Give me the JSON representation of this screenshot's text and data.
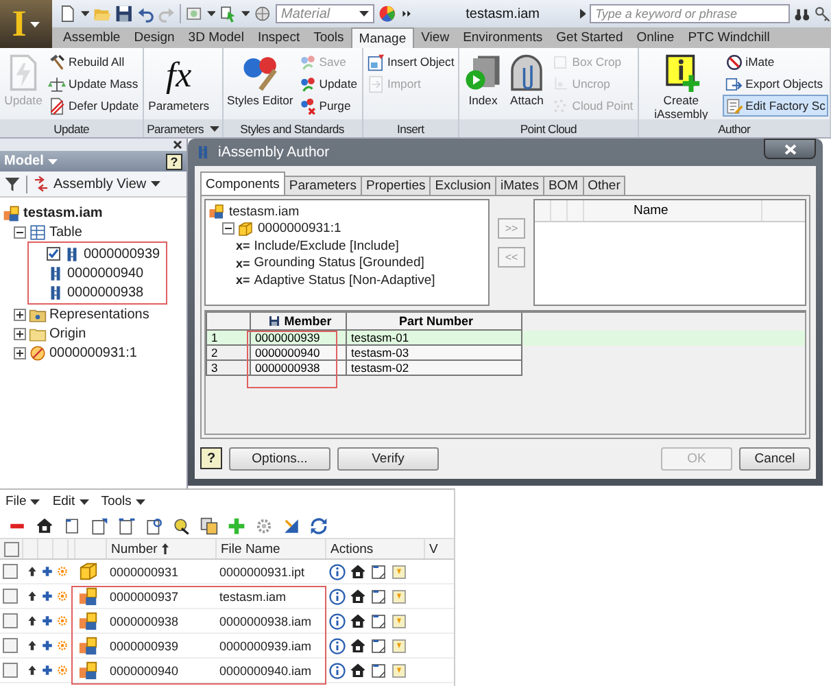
{
  "app_button": {
    "label": "I"
  },
  "quick_access": {
    "material": "Material"
  },
  "title": "testasm.iam",
  "search": {
    "placeholder": "Type a keyword or phrase"
  },
  "ribbon_tabs": [
    {
      "label": "Assemble",
      "selected": false
    },
    {
      "label": "Design",
      "selected": false
    },
    {
      "label": "3D Model",
      "selected": false
    },
    {
      "label": "Inspect",
      "selected": false
    },
    {
      "label": "Tools",
      "selected": false
    },
    {
      "label": "Manage",
      "selected": true
    },
    {
      "label": "View",
      "selected": false
    },
    {
      "label": "Environments",
      "selected": false
    },
    {
      "label": "Get Started",
      "selected": false
    },
    {
      "label": "Online",
      "selected": false
    },
    {
      "label": "PTC Windchill",
      "selected": false
    }
  ],
  "ribbon_panels": [
    {
      "title": "Update",
      "menu": false,
      "items": [
        {
          "kind": "large",
          "label": "Update",
          "disabled": true,
          "highlighted": false
        },
        {
          "kind": "small",
          "label": "Rebuild All",
          "disabled": false,
          "highlighted": false
        },
        {
          "kind": "small",
          "label": "Update Mass",
          "disabled": false,
          "highlighted": false
        },
        {
          "kind": "small",
          "label": "Defer Update",
          "disabled": false,
          "highlighted": false
        }
      ]
    },
    {
      "title": "Parameters",
      "menu": true,
      "items": [
        {
          "kind": "large",
          "label": "Parameters",
          "symbol": "fx",
          "disabled": false,
          "highlighted": false
        }
      ]
    },
    {
      "title": "Styles and Standards",
      "menu": false,
      "items": [
        {
          "kind": "large",
          "label": "Styles Editor",
          "disabled": false,
          "highlighted": false
        },
        {
          "kind": "small",
          "label": "Save",
          "disabled": true,
          "highlighted": false
        },
        {
          "kind": "small",
          "label": "Update",
          "disabled": false,
          "highlighted": false
        },
        {
          "kind": "small",
          "label": "Purge",
          "disabled": false,
          "highlighted": false
        }
      ]
    },
    {
      "title": "Insert",
      "menu": false,
      "items": [
        {
          "kind": "small",
          "label": "Insert Object",
          "disabled": false,
          "highlighted": false
        },
        {
          "kind": "small",
          "label": "Import",
          "disabled": true,
          "highlighted": false
        }
      ]
    },
    {
      "title": "Point Cloud",
      "menu": false,
      "items": [
        {
          "kind": "large",
          "label": "Index",
          "disabled": false,
          "highlighted": false
        },
        {
          "kind": "large",
          "label": "Attach",
          "disabled": false,
          "highlighted": false
        },
        {
          "kind": "small",
          "label": "Box Crop",
          "disabled": true,
          "highlighted": false
        },
        {
          "kind": "small",
          "label": "Uncrop",
          "disabled": true,
          "highlighted": false
        },
        {
          "kind": "small",
          "label": "Cloud Point",
          "disabled": true,
          "highlighted": false
        }
      ]
    },
    {
      "title": "Author",
      "menu": false,
      "items": [
        {
          "kind": "large",
          "label": "Create iAssembly",
          "disabled": false,
          "highlighted": false
        },
        {
          "kind": "small",
          "label": "iMate",
          "disabled": false,
          "highlighted": false
        },
        {
          "kind": "small",
          "label": "Export Objects",
          "disabled": false,
          "highlighted": false
        },
        {
          "kind": "small",
          "label": "Edit Factory Sc",
          "disabled": false,
          "highlighted": true
        }
      ]
    }
  ],
  "model_browser": {
    "title": "Model",
    "help": "?",
    "view": "Assembly View",
    "tree": [
      {
        "label": "testasm.iam",
        "kind": "assembly",
        "children": [
          {
            "label": "Table",
            "kind": "table",
            "expanded": true,
            "children": [
              {
                "label": "0000000939",
                "kind": "member",
                "checked": true,
                "outlined": true
              },
              {
                "label": "0000000940",
                "kind": "member",
                "checked": false,
                "outlined": true
              },
              {
                "label": "0000000938",
                "kind": "member",
                "checked": false,
                "outlined": true
              }
            ]
          },
          {
            "label": "Representations",
            "kind": "representations",
            "expanded": false
          },
          {
            "label": "Origin",
            "kind": "folder",
            "expanded": false
          },
          {
            "label": "0000000931:1",
            "kind": "occurrence",
            "expanded": false
          }
        ]
      }
    ]
  },
  "dialog": {
    "title": "iAssembly Author",
    "tabs": [
      {
        "label": "Components",
        "selected": true
      },
      {
        "label": "Parameters",
        "selected": false
      },
      {
        "label": "Properties",
        "selected": false
      },
      {
        "label": "Exclusion",
        "selected": false
      },
      {
        "label": "iMates",
        "selected": false
      },
      {
        "label": "BOM",
        "selected": false
      },
      {
        "label": "Other",
        "selected": false
      }
    ],
    "tree": [
      {
        "label": "testasm.iam",
        "kind": "assembly",
        "children": [
          {
            "label": "0000000931:1",
            "kind": "part",
            "expanded": true,
            "children": [
              {
                "label": "Include/Exclude [Include]",
                "kind": "parameter",
                "symbol": "x="
              },
              {
                "label": "Grounding Status [Grounded]",
                "kind": "parameter",
                "symbol": "x="
              },
              {
                "label": "Adaptive Status [Non-Adaptive]",
                "kind": "parameter",
                "symbol": "x="
              }
            ]
          }
        ]
      }
    ],
    "move_buttons": [
      {
        "label": ">>",
        "disabled": true
      },
      {
        "label": "<<",
        "disabled": true
      }
    ],
    "selected_list": {
      "columns": [
        "Name"
      ]
    },
    "table": {
      "columns": [
        {
          "label": "Member",
          "outlined": true
        },
        {
          "label": "Part Number",
          "outlined": false
        }
      ],
      "rows": [
        {
          "number": "1",
          "cells": [
            "0000000939",
            "testasm-01"
          ],
          "selected": true
        },
        {
          "number": "2",
          "cells": [
            "0000000940",
            "testasm-03"
          ],
          "selected": false
        },
        {
          "number": "3",
          "cells": [
            "0000000938",
            "testasm-02"
          ],
          "selected": false
        }
      ]
    },
    "help": "?",
    "buttons": [
      {
        "label": "Options...",
        "disabled": false
      },
      {
        "label": "Verify",
        "disabled": false
      },
      {
        "label": "OK",
        "disabled": true
      },
      {
        "label": "Cancel",
        "disabled": false
      }
    ]
  },
  "pdm": {
    "menus": [
      {
        "label": "File"
      },
      {
        "label": "Edit"
      },
      {
        "label": "Tools"
      }
    ],
    "all_checked": false,
    "columns": [
      {
        "label": "Number",
        "sorted": true
      },
      {
        "label": "File Name",
        "sorted": false
      },
      {
        "label": "Actions",
        "sorted": false
      },
      {
        "label": "V",
        "sorted": false
      }
    ],
    "rows": [
      {
        "checked": false,
        "kind": "part",
        "number": "0000000931",
        "file_name": "0000000931.ipt",
        "outlined": false
      },
      {
        "checked": false,
        "kind": "assembly",
        "number": "0000000937",
        "file_name": "testasm.iam",
        "outlined": true
      },
      {
        "checked": false,
        "kind": "assembly",
        "number": "0000000938",
        "file_name": "0000000938.iam",
        "outlined": true
      },
      {
        "checked": false,
        "kind": "assembly",
        "number": "0000000939",
        "file_name": "0000000939.iam",
        "outlined": true
      },
      {
        "checked": false,
        "kind": "assembly",
        "number": "0000000940",
        "file_name": "0000000940.iam",
        "outlined": true
      }
    ]
  }
}
